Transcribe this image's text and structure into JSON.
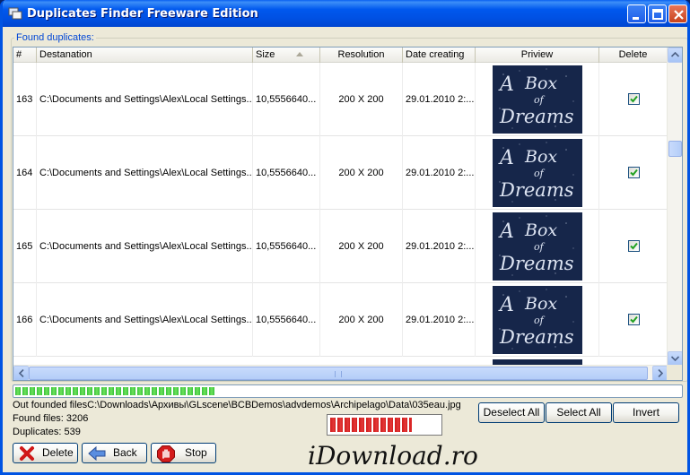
{
  "window": {
    "title": "Duplicates Finder Freeware Edition"
  },
  "group": {
    "label": "Found duplicates:"
  },
  "table": {
    "columns": [
      "#",
      "Destanation",
      "Size",
      "Resolution",
      "Date creating",
      "Priview",
      "Delete"
    ],
    "sorted_column": "Size",
    "rows": [
      {
        "num": "163",
        "destination": "C:\\Documents and Settings\\Alex\\Local Settings...",
        "size": "10,5556640...",
        "resolution": "200 X 200",
        "date": "29.01.2010 2:...",
        "preview": "thumbnail-box-of-dreams",
        "delete": true
      },
      {
        "num": "164",
        "destination": "C:\\Documents and Settings\\Alex\\Local Settings...",
        "size": "10,5556640...",
        "resolution": "200 X 200",
        "date": "29.01.2010 2:...",
        "preview": "thumbnail-box-of-dreams",
        "delete": true
      },
      {
        "num": "165",
        "destination": "C:\\Documents and Settings\\Alex\\Local Settings...",
        "size": "10,5556640...",
        "resolution": "200 X 200",
        "date": "29.01.2010 2:...",
        "preview": "thumbnail-box-of-dreams",
        "delete": true
      },
      {
        "num": "166",
        "destination": "C:\\Documents and Settings\\Alex\\Local Settings...",
        "size": "10,5556640...",
        "resolution": "200 X 200",
        "date": "29.01.2010 2:...",
        "preview": "thumbnail-box-of-dreams",
        "delete": true
      }
    ],
    "preview_text": "A Box of Dreams"
  },
  "scan_progress": {
    "fill_fraction": 0.3
  },
  "status": {
    "current_file": "Out founded filesC:\\Downloads\\Архивы\\GLscene\\BCBDemos\\advdemos\\Archipelago\\Data\\035eau.jpg",
    "found_files": "Found files: 3206",
    "duplicates": "Duplicates: 539"
  },
  "buttons": {
    "deselect_all": "Deselect All",
    "select_all": "Select All",
    "invert": "Invert",
    "delete": "Delete",
    "back": "Back",
    "stop": "Stop"
  },
  "delete_progress": {
    "fill_fraction": 0.75
  },
  "watermark": "iDownload.ro",
  "colors": {
    "titlebar": "#0054e3",
    "group_label": "#0046d5",
    "progress_green": "#35c23a",
    "progress_red": "#d11a1a",
    "checkbox_check": "#21a121"
  }
}
